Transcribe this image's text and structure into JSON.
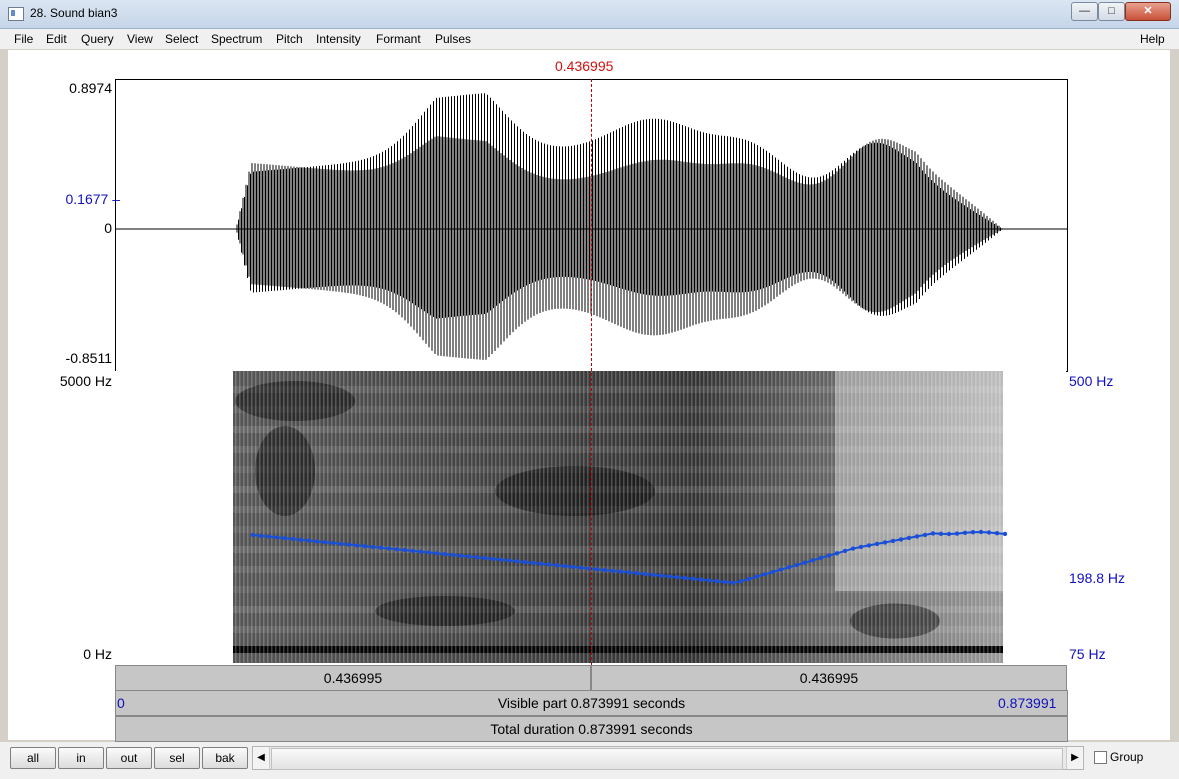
{
  "window": {
    "title": "28. Sound bian3",
    "minimize": "—",
    "maximize": "□",
    "close": "✕"
  },
  "menu": [
    "File",
    "Edit",
    "Query",
    "View",
    "Select",
    "Spectrum",
    "Pitch",
    "Intensity",
    "Formant",
    "Pulses",
    "Help"
  ],
  "cursor": {
    "time_label": "0.436995"
  },
  "waveform": {
    "y_max": "0.8974",
    "y_cursor": "0.1677",
    "y_zero": "0",
    "y_min": "-0.8511"
  },
  "spectrogram": {
    "freq_top": "5000 Hz",
    "freq_bottom": "0 Hz",
    "pitch_top": "500 Hz",
    "pitch_mid": "198.8 Hz",
    "pitch_bottom": "75 Hz",
    "pitch_color": "#1a4fd6"
  },
  "timebars": {
    "left_segment": "0.436995",
    "right_segment": "0.436995",
    "visible_start": "0",
    "visible_label": "Visible part 0.873991 seconds",
    "visible_end": "0.873991",
    "total_label": "Total duration 0.873991 seconds"
  },
  "controls": {
    "buttons": [
      "all",
      "in",
      "out",
      "sel",
      "bak"
    ],
    "group_label": "Group",
    "group_checked": false
  }
}
